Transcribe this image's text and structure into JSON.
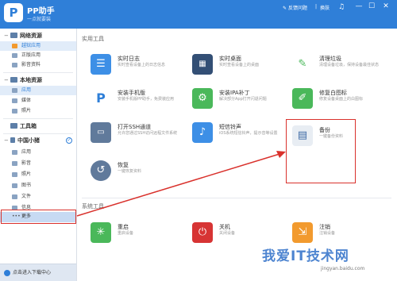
{
  "titlebar": {
    "logo_text": "P",
    "app_name": "PP助手",
    "subtitle": "一点就要装",
    "feedback_link": "反馈问题",
    "skin_link": "换肤",
    "controls": [
      "—",
      "☐",
      "✕"
    ]
  },
  "sidebar": {
    "net_resources": {
      "label": "网络资源",
      "items": [
        "越狱应用",
        "正版应用",
        "影音资料"
      ]
    },
    "local_resources": {
      "label": "本地资源",
      "items": [
        "应用",
        "媒体",
        "照片"
      ]
    },
    "toolbox_label": "工具箱",
    "device": {
      "label": "中国小猪",
      "items": [
        "应用",
        "影音",
        "照片",
        "图书",
        "文件",
        "信息",
        "更多"
      ]
    },
    "footer_label": "点击进入下载中心"
  },
  "main": {
    "practical_tools_title": "实用工具",
    "system_tools_title": "系统工具",
    "practical_tools": [
      {
        "name": "实时日志",
        "desc": "实时查看设备上的日志信息",
        "icon": "log-icon",
        "color": "#3d8fe6"
      },
      {
        "name": "实时桌面",
        "desc": "实时查看设备上的桌面",
        "icon": "desktop-icon",
        "color": "#334f75"
      },
      {
        "name": "清理垃圾",
        "desc": "清理设备垃圾，保持设备最佳状态",
        "icon": "broom-icon",
        "color": "#4ab85a"
      },
      {
        "name": "安装手机版",
        "desc": "安装手机版PP助手，免费装应用",
        "icon": "pp-logo-icon",
        "color": "#ffffff"
      },
      {
        "name": "安装IPA补丁",
        "desc": "解决部分App打开闪退问题",
        "icon": "gear-icon",
        "color": "#4ab85a"
      },
      {
        "name": "修复白图标",
        "desc": "修复设备桌面上的白图标",
        "icon": "wrench-icon",
        "color": "#4ab85a"
      },
      {
        "name": "打开SSH通道",
        "desc": "允许您通过SSH访问远程文件系统",
        "icon": "terminal-icon",
        "color": "#607a9b"
      },
      {
        "name": "短信铃声",
        "desc": "iOS系统短信铃声，提示音等设置",
        "icon": "bird-icon",
        "color": "#3d8fe6"
      },
      {
        "name": "备份",
        "desc": "一键备份资料",
        "icon": "backup-icon",
        "color": "#e8edf3"
      },
      {
        "name": "恢复",
        "desc": "一键恢复资料",
        "icon": "restore-icon",
        "color": "#607a9b"
      }
    ],
    "system_tools": [
      {
        "name": "重启",
        "desc": "重启设备",
        "icon": "restart-icon",
        "color": "#4ab85a"
      },
      {
        "name": "关机",
        "desc": "关闭设备",
        "icon": "power-icon",
        "color": "#d73434"
      },
      {
        "name": "注销",
        "desc": "注销设备",
        "icon": "logout-icon",
        "color": "#f29a2e"
      }
    ]
  },
  "watermark": {
    "text": "我爱IT技术网",
    "url": "jingyan.baidu.com"
  },
  "accent_color": "#2f7fd8",
  "highlight_color": "#d9312c"
}
